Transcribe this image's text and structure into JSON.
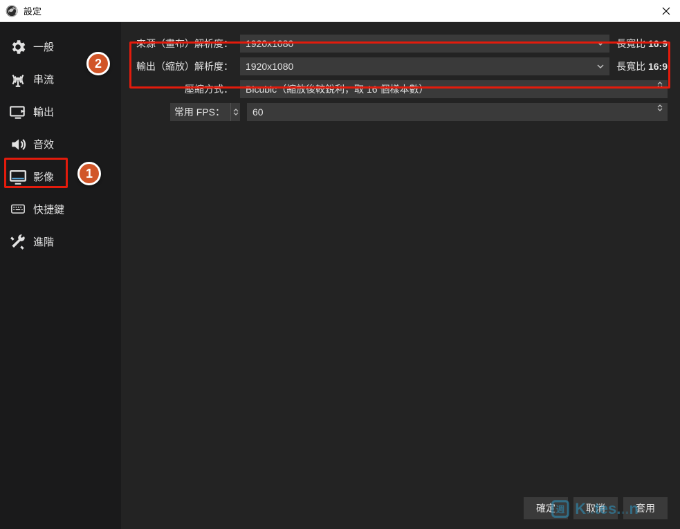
{
  "titlebar": {
    "title": "設定"
  },
  "sidebar": {
    "items": [
      {
        "label": "一般"
      },
      {
        "label": "串流"
      },
      {
        "label": "輸出"
      },
      {
        "label": "音效"
      },
      {
        "label": "影像"
      },
      {
        "label": "快捷鍵"
      },
      {
        "label": "進階"
      }
    ]
  },
  "annotations": {
    "badge1": "1",
    "badge2": "2"
  },
  "settings": {
    "base_resolution": {
      "label": "來源（畫布）解析度：",
      "value": "1920x1080",
      "aspect_label": "長寬比",
      "aspect_value": "16:9"
    },
    "output_resolution": {
      "label": "輸出（縮放）解析度：",
      "value": "1920x1080",
      "aspect_label": "長寬比",
      "aspect_value": "16:9"
    },
    "downscale": {
      "label": "壓縮方式：",
      "value": "Bicubic（縮放後較銳利，取 16 個樣本數）"
    },
    "fps": {
      "label": "常用 FPS：",
      "value": "60"
    }
  },
  "footer": {
    "ok": "確定",
    "cancel": "取消",
    "apply": "套用"
  },
  "watermark": {
    "text_left": "K",
    "text_mid": "tes.",
    "text_right": "n"
  }
}
